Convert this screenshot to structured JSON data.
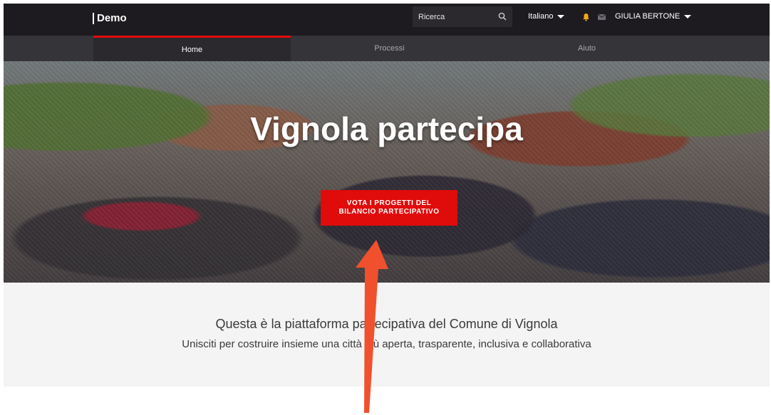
{
  "header": {
    "brand": "Demo",
    "search_placeholder": "Ricerca",
    "language": "Italiano",
    "user": "GIULIA BERTONE"
  },
  "nav": {
    "items": [
      {
        "label": "Home",
        "active": true
      },
      {
        "label": "Processi",
        "active": false
      },
      {
        "label": "Aiuto",
        "active": false
      }
    ]
  },
  "hero": {
    "title": "Vignola partecipa",
    "cta_label": "VOTA I PROGETTI DEL BILANCIO PARTECIPATIVO"
  },
  "intro": {
    "title": "Questa è la piattaforma partecipativa del Comune di Vignola",
    "subtitle": "Unisciti per costruire insieme una città più aperta, trasparente, inclusiva e collaborativa"
  },
  "colors": {
    "topbar": "#1d1b1f",
    "nav": "#353438",
    "accent": "#e20b0b",
    "bell": "#f5a623",
    "annotation_arrow": "#f0502e"
  },
  "icons": {
    "search": "search-icon",
    "bell": "bell-icon",
    "mail": "mail-icon",
    "caret": "caret-down-icon"
  }
}
